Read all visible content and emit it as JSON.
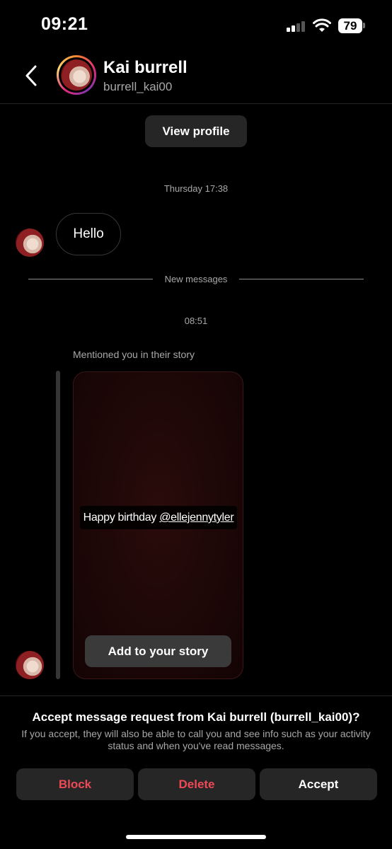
{
  "status_bar": {
    "time": "09:21",
    "battery": "79"
  },
  "header": {
    "name": "Kai burrell",
    "username": "burrell_kai00"
  },
  "view_profile_label": "View profile",
  "thread": {
    "timestamp_1": "Thursday 17:38",
    "message_hello": "Hello",
    "new_messages_label": "New messages",
    "timestamp_2": "08:51",
    "mention_label": "Mentioned you in their story",
    "story_text": "Happy birthday",
    "story_mention": "@ellejennytyler",
    "add_to_story_label": "Add to your story"
  },
  "request": {
    "title": "Accept message request from Kai burrell (burrell_kai00)?",
    "description": "If you accept, they will also be able to call you and see info such as your activity status and when you've read messages.",
    "block_label": "Block",
    "delete_label": "Delete",
    "accept_label": "Accept"
  },
  "colors": {
    "danger": "#ed4956",
    "background": "#000000",
    "button_bg": "#262626"
  }
}
